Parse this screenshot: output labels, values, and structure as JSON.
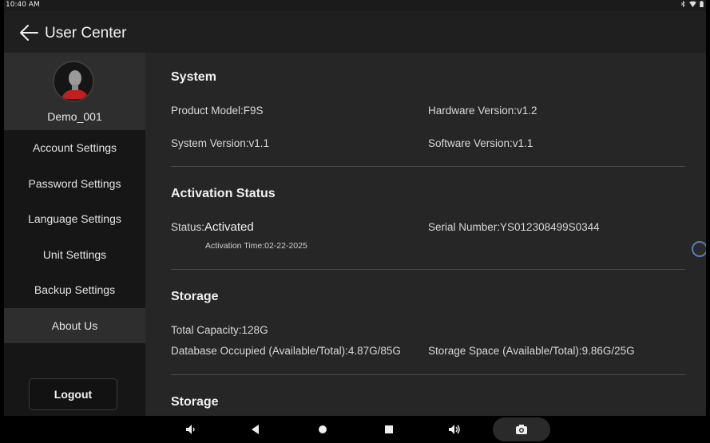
{
  "status_bar": {
    "time": "10:40 AM",
    "icons": [
      "bluetooth-icon",
      "wifi-icon",
      "battery-icon"
    ]
  },
  "header": {
    "back_icon": "arrow-left-icon",
    "title": "User Center"
  },
  "sidebar": {
    "username": "Demo_001",
    "avatar_icon": "user-avatar-icon",
    "items": [
      {
        "label": "Account Settings",
        "active": false
      },
      {
        "label": "Password Settings",
        "active": false
      },
      {
        "label": "Language Settings",
        "active": false
      },
      {
        "label": "Unit Settings",
        "active": false
      },
      {
        "label": "Backup Settings",
        "active": false
      },
      {
        "label": "About Us",
        "active": true
      }
    ],
    "logout_label": "Logout"
  },
  "content": {
    "system": {
      "title": "System",
      "product_model": "Product Model:F9S",
      "hardware_version": "Hardware Version:v1.2",
      "system_version": "System Version:v1.1",
      "software_version": "Software Version:v1.1"
    },
    "activation": {
      "title": "Activation Status",
      "status_label": "Status:",
      "status_value": "Activated",
      "activation_time": "Activation Time:02-22-2025",
      "serial_number": "Serial Number:YS012308499S0344"
    },
    "storage": {
      "title": "Storage",
      "total_capacity": "Total Capacity:128G",
      "database_occupied": "Database Occupied (Available/Total):4.87G/85G",
      "storage_space": "Storage Space (Available/Total):9.86G/25G"
    },
    "storage2": {
      "title": "Storage"
    }
  },
  "nav_bar": {
    "buttons": [
      "volume-down-icon",
      "back-triangle-icon",
      "home-circle-icon",
      "recents-square-icon",
      "volume-up-icon",
      "camera-icon"
    ]
  },
  "colors": {
    "background": "#262626",
    "sidebar": "#161616",
    "active_item": "#2e2e2e",
    "spinner_accent": "#5a79b8"
  }
}
